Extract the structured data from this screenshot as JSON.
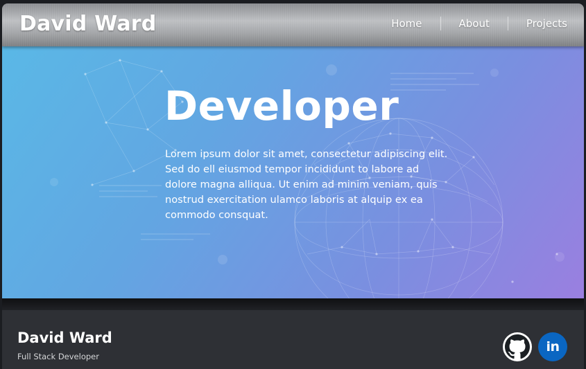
{
  "header": {
    "brand": "David Ward",
    "nav": [
      {
        "label": "Home"
      },
      {
        "label": "About"
      },
      {
        "label": "Projects"
      }
    ]
  },
  "hero": {
    "title": "Developer",
    "lines": [
      "Lorem ipsum dolor sit amet, consectetur adipiscing elit.",
      "Sed do ell eiusmod tempor incididunt to labore ad",
      "dolore magna alliqua. Ut enim ad minim veniam, quis",
      "nostrud exercitation ulamco laboris at alquip ex ea",
      "commodo consquat."
    ]
  },
  "footer": {
    "name": "David Ward",
    "subtitle": "Full Stack Developer",
    "social": [
      {
        "icon": "github-icon"
      },
      {
        "icon": "linkedin-icon",
        "label": "in"
      }
    ]
  },
  "colors": {
    "hero_start": "#5ab8e6",
    "hero_end": "#9a7fe0",
    "footer_bg": "#2e3035",
    "linkedin_blue": "#0a66c2"
  }
}
